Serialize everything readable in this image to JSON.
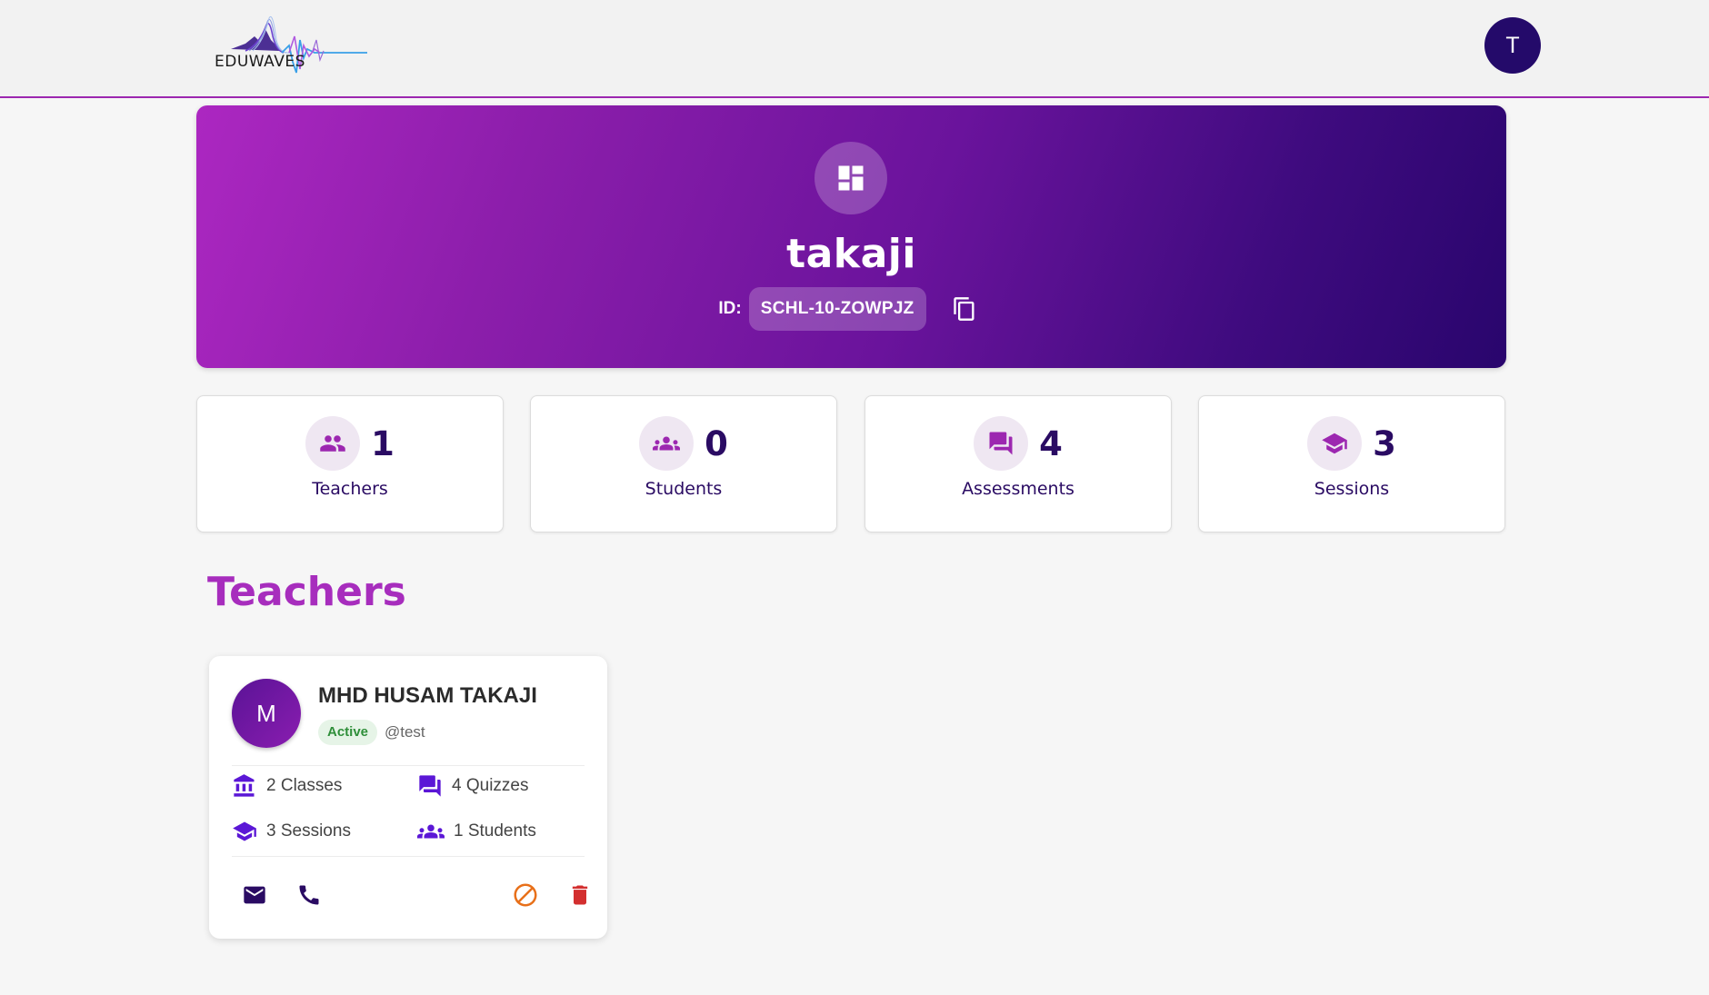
{
  "header": {
    "logo_text": "EDUWAVES",
    "avatar_letter": "T"
  },
  "school": {
    "name": "takaji",
    "id_label": "ID:",
    "id_value": "SCHL-10-ZOWPJZ"
  },
  "stats": [
    {
      "value": "1",
      "label": "Teachers",
      "icon": "people-icon"
    },
    {
      "value": "0",
      "label": "Students",
      "icon": "groups-icon"
    },
    {
      "value": "4",
      "label": "Assessments",
      "icon": "forum-icon"
    },
    {
      "value": "3",
      "label": "Sessions",
      "icon": "school-icon"
    }
  ],
  "section_title": "Teachers",
  "teacher": {
    "avatar_letter": "M",
    "name": "MHD HUSAM TAKAJI",
    "status": "Active",
    "username": "@test",
    "classes": "2 Classes",
    "quizzes": "4 Quizzes",
    "sessions": "3 Sessions",
    "students": "1 Students"
  },
  "colors": {
    "brand_purple": "#9c27b0",
    "dark_purple": "#2a0b63",
    "icon_purple": "#5b17d6",
    "active_green": "#2f8f3a",
    "block_orange": "#e8701a",
    "delete_red": "#d32f2f"
  }
}
